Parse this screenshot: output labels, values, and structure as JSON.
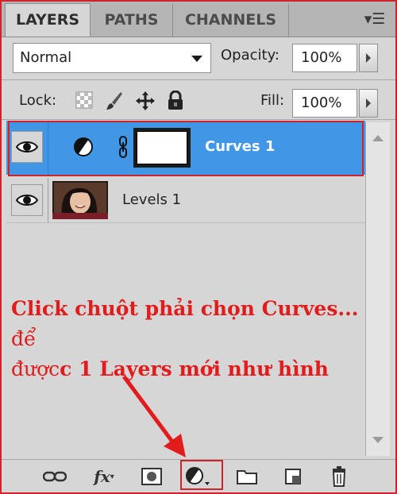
{
  "tabs": [
    {
      "label": "LAYERS",
      "active": true
    },
    {
      "label": "PATHS",
      "active": false
    },
    {
      "label": "CHANNELS",
      "active": false
    }
  ],
  "panel_menu_icon": "panel-menu-icon",
  "blend_mode": "Normal",
  "opacity": {
    "label": "Opacity:",
    "value": "100%"
  },
  "lock": {
    "label": "Lock:",
    "icons": [
      "lock-transparent-icon",
      "lock-brush-icon",
      "lock-move-icon",
      "lock-all-icon"
    ]
  },
  "fill": {
    "label": "Fill:",
    "value": "100%"
  },
  "layers": [
    {
      "name": "Curves 1",
      "type": "adjustment",
      "selected": true,
      "visible": true
    },
    {
      "name": "Levels 1",
      "type": "image",
      "selected": false,
      "visible": true
    }
  ],
  "annotation": {
    "part1": "Click chuột phải chọn Curves...",
    "part2": " để",
    "part3": "được",
    "part4": "c 1 Layers mới như hình"
  },
  "bottom_tools": [
    "link-icon",
    "fx-icon",
    "add-mask-icon",
    "new-adjustment-layer-icon",
    "new-group-icon",
    "new-layer-icon",
    "delete-icon"
  ],
  "colors": {
    "accent": "#3f97e6",
    "highlight": "#d2232a",
    "panel": "#d6d6d6"
  }
}
